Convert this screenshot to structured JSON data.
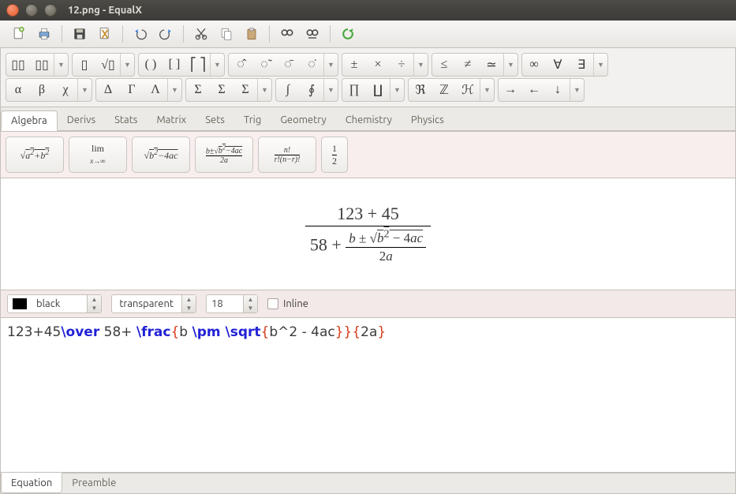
{
  "window": {
    "title": "12.png - EqualX"
  },
  "toolbar": {
    "buttons": [
      "new",
      "print",
      "save",
      "export",
      "undo",
      "redo",
      "cut",
      "copy",
      "paste",
      "find",
      "find-replace",
      "refresh"
    ]
  },
  "symbol_rows": [
    [
      {
        "key": "frac-boxes",
        "cells": [
          "▯▯",
          "▯▯"
        ]
      },
      {
        "key": "sum-sub",
        "cells": [
          "▯",
          "√▯"
        ]
      },
      {
        "key": "delims",
        "cells": [
          "( )",
          "[ ]",
          "⎡ ⎤"
        ]
      },
      {
        "key": "accents",
        "cells": [
          "◌̂",
          "◌̃",
          "◌̄",
          "◌̇"
        ]
      },
      {
        "key": "ops",
        "cells": [
          "±",
          "×",
          "÷"
        ]
      },
      {
        "key": "rel",
        "cells": [
          "≤",
          "≠",
          "≃"
        ]
      },
      {
        "key": "logic",
        "cells": [
          "∞",
          "∀",
          "∃"
        ]
      }
    ],
    [
      {
        "key": "greek",
        "cells": [
          "α",
          "β",
          "χ"
        ]
      },
      {
        "key": "greek-upper",
        "cells": [
          "Δ",
          "Γ",
          "Λ"
        ]
      },
      {
        "key": "bigops",
        "cells": [
          "Σ",
          "Σ",
          "Σ"
        ]
      },
      {
        "key": "integrals",
        "cells": [
          "∫",
          "∮"
        ]
      },
      {
        "key": "prod",
        "cells": [
          "∏",
          "∐"
        ]
      },
      {
        "key": "sets",
        "cells": [
          "ℜ",
          "ℤ",
          "ℋ"
        ]
      },
      {
        "key": "arrows",
        "cells": [
          "→",
          "←",
          "↓"
        ]
      }
    ]
  ],
  "tabs": {
    "top": [
      "Algebra",
      "Derivs",
      "Stats",
      "Matrix",
      "Sets",
      "Trig",
      "Geometry",
      "Chemistry",
      "Physics"
    ],
    "top_active": 0,
    "bottom": [
      "Equation",
      "Preamble"
    ],
    "bottom_active": 0
  },
  "templates": [
    "\\sqrt{a^2+b^2}",
    "\\lim_{x\\to\\infty}",
    "\\sqrt{b^2-4ac}",
    "\\frac{b\\pm\\sqrt{b^2-4ac}}{2a}",
    "\\frac{n!}{r!(n-r)!}",
    "\\frac{1}{2}"
  ],
  "preview": {
    "numerator": "123 + 45",
    "denom_prefix": "58 + ",
    "sub_num": "b ± √(b² − 4ac)",
    "sub_den": "2a"
  },
  "controls": {
    "fg_color_label": "black",
    "bg_color_label": "transparent",
    "font_size": "18",
    "inline_label": "Inline",
    "inline_checked": false
  },
  "source": {
    "tokens": [
      {
        "t": "123+45",
        "c": "plain"
      },
      {
        "t": "\\over",
        "c": "cmd"
      },
      {
        "t": " 58+ ",
        "c": "plain"
      },
      {
        "t": "\\frac",
        "c": "cmd"
      },
      {
        "t": "{",
        "c": "brace"
      },
      {
        "t": "b ",
        "c": "plain"
      },
      {
        "t": "\\pm \\sqrt",
        "c": "cmd"
      },
      {
        "t": "{",
        "c": "brace"
      },
      {
        "t": "b^2 - 4ac",
        "c": "plain"
      },
      {
        "t": "}}{",
        "c": "brace"
      },
      {
        "t": "2a",
        "c": "plain"
      },
      {
        "t": "}",
        "c": "brace"
      }
    ]
  }
}
